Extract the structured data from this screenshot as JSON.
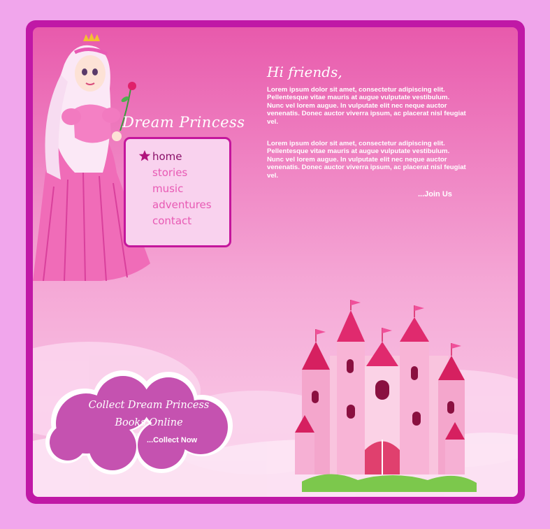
{
  "site": {
    "title": "Dream Princess"
  },
  "nav": {
    "items": [
      {
        "label": "home",
        "active": true
      },
      {
        "label": "stories",
        "active": false
      },
      {
        "label": "music",
        "active": false
      },
      {
        "label": "adventures",
        "active": false
      },
      {
        "label": "contact",
        "active": false
      }
    ]
  },
  "intro": {
    "greeting": "Hi friends,",
    "paragraphs": [
      "Lorem ipsum dolor sit amet, consectetur adipiscing elit. Pellentesque vitae mauris at augue vulputate vestibulum. Nunc vel lorem augue. In vulputate elit nec neque auctor venenatis. Donec auctor viverra ipsum, ac placerat nisl feugiat vel.",
      "Lorem ipsum dolor sit amet, consectetur adipiscing elit. Pellentesque vitae mauris at augue vulputate vestibulum. Nunc vel lorem augue. In vulputate elit nec neque auctor venenatis. Donec auctor viverra ipsum, ac placerat nisl feugiat vel."
    ],
    "join_link": "...Join Us"
  },
  "promo": {
    "line1": "Collect Dream Princess",
    "line2": "Books Online",
    "link": "...Collect Now"
  },
  "colors": {
    "page_bg": "#f1a6ec",
    "frame": "#c018a6",
    "panel_top": "#e85aac",
    "nav_bg": "#f9d2ee",
    "nav_text": "#e85ab4",
    "nav_active": "#8a1068",
    "promo_cloud": "#c552b0"
  },
  "icons": {
    "nav_marker": "star-icon",
    "illustration_left": "princess-illustration",
    "illustration_right": "castle-illustration"
  }
}
